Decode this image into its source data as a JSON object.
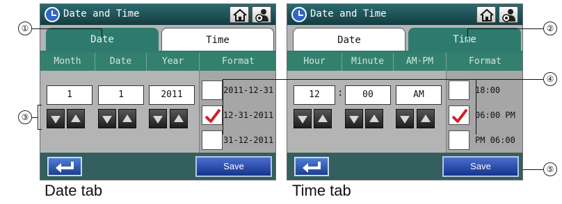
{
  "date_tab_screen": {
    "title": "Date and Time",
    "tabs": [
      "Date",
      "Time"
    ],
    "active_tab": "Date",
    "headers": [
      "Month",
      "Date",
      "Year",
      "Format"
    ],
    "values": [
      "1",
      "1",
      "2011"
    ],
    "formats": [
      {
        "label": "2011-12-31",
        "checked": false
      },
      {
        "label": "12-31-2011",
        "checked": true
      },
      {
        "label": "31-12-2011",
        "checked": false
      }
    ],
    "save_label": "Save",
    "caption": "Date tab"
  },
  "time_tab_screen": {
    "title": "Date and Time",
    "tabs": [
      "Date",
      "Time"
    ],
    "active_tab": "Time",
    "headers": [
      "Hour",
      "Minute",
      "AM·PM",
      "Format"
    ],
    "values": [
      "12",
      "00",
      "AM"
    ],
    "separator": ":",
    "formats": [
      {
        "label": "18:00",
        "checked": false
      },
      {
        "label": "06:00 PM",
        "checked": true
      },
      {
        "label": "PM 06:00",
        "checked": false
      }
    ],
    "save_label": "Save",
    "caption": "Time tab"
  },
  "callouts": [
    "①",
    "②",
    "③",
    "④",
    "⑤"
  ],
  "colors": {
    "title_bar": "#1f4f52",
    "active_tab": "#2e7b6e",
    "panel_bg": "#b4b4b4",
    "footer": "#335f5e",
    "save_button": "#2a4fb0",
    "check_mark": "#d0202a"
  },
  "icons": {
    "title": "clock-icon",
    "home": "home-icon",
    "user_settings": "user-settings-icon",
    "back": "return-arrow-icon",
    "spin_down": "triangle-down-icon",
    "spin_up": "triangle-up-icon",
    "check": "check-mark-icon"
  }
}
